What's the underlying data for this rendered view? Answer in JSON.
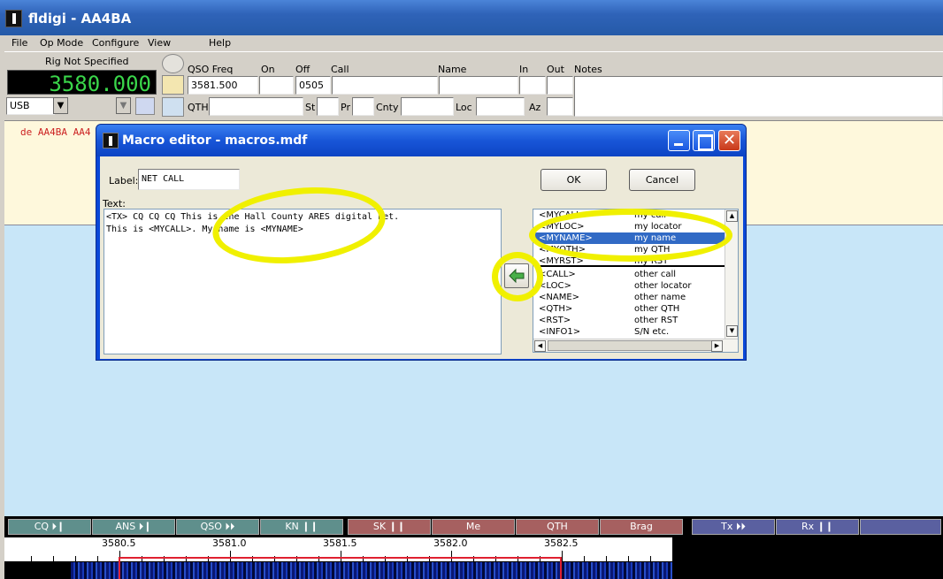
{
  "app": {
    "title": "fldigi - AA4BA"
  },
  "menu": [
    "File",
    "Op Mode",
    "Configure",
    "View",
    "Help"
  ],
  "rig": {
    "label": "Rig Not Specified",
    "frequency": "3580.000",
    "mode": "USB"
  },
  "qso": {
    "freq_label": "QSO Freq",
    "freq_value": "3581.500",
    "on_label": "On",
    "on_value": "",
    "off_label": "Off",
    "off_value": "0505",
    "call_label": "Call",
    "call_value": "",
    "name_label": "Name",
    "name_value": "",
    "in_label": "In",
    "in_value": "",
    "out_label": "Out",
    "out_value": "",
    "notes_label": "Notes",
    "notes_value": "",
    "qth_label": "QTH",
    "qth_value": "",
    "st_label": "St",
    "st_value": "",
    "pr_label": "Pr",
    "pr_value": "",
    "cnty_label": "Cnty",
    "cnty_value": "",
    "loc_label": "Loc",
    "loc_value": "",
    "az_label": "Az",
    "az_value": ""
  },
  "rx_text": "de AA4BA AA4",
  "macro_buttons": [
    {
      "label": "CQ ⏵❙",
      "group": 1
    },
    {
      "label": "ANS ⏵❙",
      "group": 1
    },
    {
      "label": "QSO ⏵⏵",
      "group": 1
    },
    {
      "label": "KN ❙❙",
      "group": 1
    },
    {
      "label": "SK ❙❙",
      "group": 2
    },
    {
      "label": "Me",
      "group": 2
    },
    {
      "label": "QTH",
      "group": 2
    },
    {
      "label": "Brag",
      "group": 2
    },
    {
      "label": "Tx ⏵⏵",
      "group": 3
    },
    {
      "label": "Rx ❙❙",
      "group": 3
    },
    {
      "label": "",
      "group": 3
    }
  ],
  "waterfall": {
    "scale_labels": [
      "3580.5",
      "3581.0",
      "3581.5",
      "3582.0",
      "3582.5"
    ]
  },
  "dialog": {
    "title": "Macro editor - macros.mdf",
    "label_caption": "Label:",
    "label_value": "NET CALL",
    "ok": "OK",
    "cancel": "Cancel",
    "text_caption": "Text:",
    "text_line1": "<TX> CQ CQ CQ This is the Hall County ARES digital net.",
    "text_line2": "This is <MYCALL>. My name is <MYNAME>",
    "tags": [
      {
        "tag": "<MYCALL>",
        "desc": "my call"
      },
      {
        "tag": "<MYLOC>",
        "desc": "my locator"
      },
      {
        "tag": "<MYNAME>",
        "desc": "my name",
        "selected": true
      },
      {
        "tag": "<MYQTH>",
        "desc": "my QTH"
      },
      {
        "tag": "<MYRST>",
        "desc": "my RST"
      },
      {
        "tag": "<CALL>",
        "desc": "other call"
      },
      {
        "tag": "<LOC>",
        "desc": "other locator"
      },
      {
        "tag": "<NAME>",
        "desc": "other name"
      },
      {
        "tag": "<QTH>",
        "desc": "other QTH"
      },
      {
        "tag": "<RST>",
        "desc": "other RST"
      },
      {
        "tag": "<INFO1>",
        "desc": "S/N etc."
      }
    ]
  },
  "colors": {
    "annotation": "#f0f000",
    "rx_background": "#fef8dc",
    "tx_background": "#c8e6f8",
    "selection": "#316ac5"
  }
}
